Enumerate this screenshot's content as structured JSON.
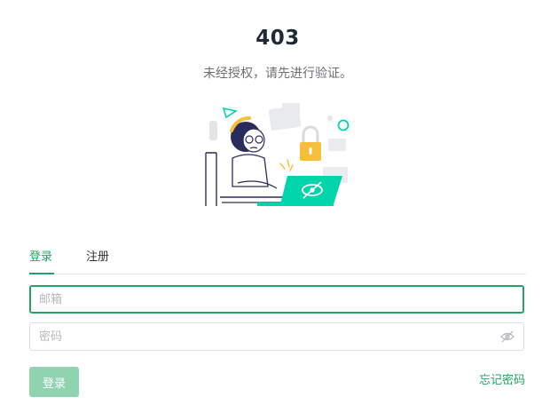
{
  "error": {
    "code": "403",
    "message": "未经授权，请先进行验证。"
  },
  "illustration": {
    "name": "locked-access-illustration",
    "colors": {
      "accent": "#00d4aa",
      "lock": "#f6bf3b",
      "ink": "#2a2d5c"
    }
  },
  "tabs": [
    {
      "label": "登录",
      "active": true
    },
    {
      "label": "注册",
      "active": false
    }
  ],
  "form": {
    "email_placeholder": "邮箱",
    "email_value": "",
    "password_placeholder": "密码",
    "password_value": "",
    "password_icon": "eye-off-icon",
    "submit_label": "登录",
    "forgot_label": "忘记密码"
  },
  "colors": {
    "brand": "#21a366",
    "button_disabled": "#8fd3b0",
    "title": "#1f2a37",
    "muted": "#6b6f78"
  }
}
